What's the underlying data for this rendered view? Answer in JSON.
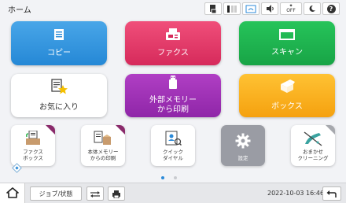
{
  "header": {
    "title": "ホーム"
  },
  "status_icons": [
    "document-status-icon",
    "toner-icon",
    "wifi-direct-icon",
    "sound-icon",
    "wireless-off-icon",
    "moon-icon",
    "help-icon"
  ],
  "status_labels": {
    "wireless_off": "OFF",
    "help": "?"
  },
  "main_tiles": [
    {
      "label": "コピー",
      "color": "#2588d6"
    },
    {
      "label": "ファクス",
      "color": "#d62a5b"
    },
    {
      "label": "スキャン",
      "color": "#18a446"
    },
    {
      "label": "お気に入り",
      "color": "#ffffff"
    },
    {
      "label_line1": "外部メモリー",
      "label_line2": "から印刷",
      "color": "#8f26a8"
    },
    {
      "label": "ボックス",
      "color": "#f5a10f"
    }
  ],
  "small_tiles": [
    {
      "line1": "ファクス",
      "line2": "ボックス"
    },
    {
      "line1": "本体メモリー",
      "line2": "からの印刷"
    },
    {
      "line1": "クイック",
      "line2": "ダイヤル"
    },
    {
      "line1": "設定"
    },
    {
      "line1": "おまかせ",
      "line2": "クリーニング"
    }
  ],
  "pagination": {
    "current": 1,
    "total": 2
  },
  "bottom_bar": {
    "job_label": "ジョブ/状態",
    "datetime": "2022-10-03 16:46"
  }
}
